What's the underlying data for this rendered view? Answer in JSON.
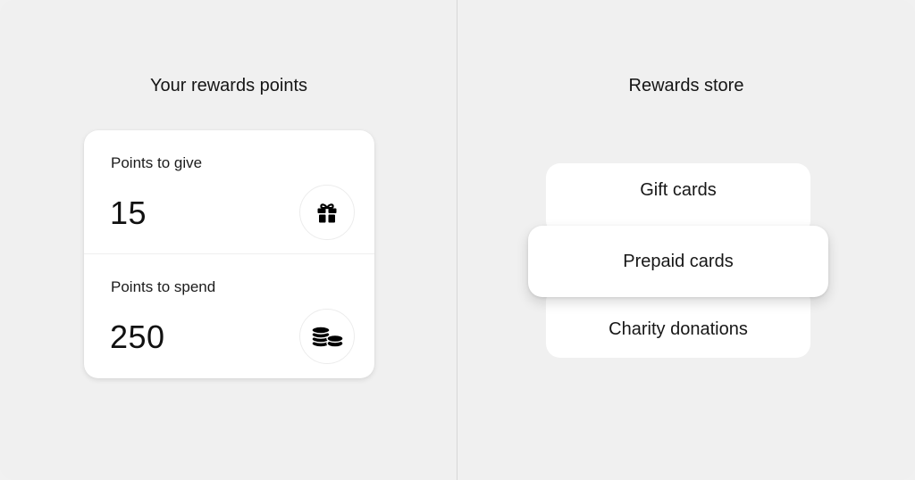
{
  "rewards_points": {
    "title": "Your rewards points",
    "give": {
      "label": "Points to give",
      "value": "15",
      "icon": "gift-icon"
    },
    "spend": {
      "label": "Points to spend",
      "value": "250",
      "icon": "coins-icon"
    }
  },
  "rewards_store": {
    "title": "Rewards store",
    "options": [
      {
        "label": "Gift cards"
      },
      {
        "label": "Prepaid cards"
      },
      {
        "label": "Charity donations"
      }
    ]
  },
  "colors": {
    "background": "#f0f0f0",
    "card": "#ffffff",
    "divider": "#d7d7d7",
    "text": "#111111"
  }
}
